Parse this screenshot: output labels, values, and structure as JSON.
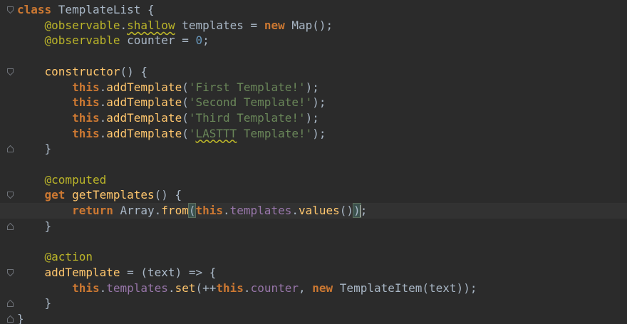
{
  "editor": {
    "lines": [
      [
        {
          "t": "class ",
          "c": "kw"
        },
        {
          "t": "TemplateList {",
          "c": ""
        }
      ],
      [
        {
          "t": "    ",
          "c": ""
        },
        {
          "t": "@observable",
          "c": "dec"
        },
        {
          "t": ".",
          "c": ""
        },
        {
          "t": "shallow",
          "c": "dec squiggle"
        },
        {
          "t": " templates = ",
          "c": ""
        },
        {
          "t": "new ",
          "c": "kw"
        },
        {
          "t": "Map();",
          "c": ""
        }
      ],
      [
        {
          "t": "    ",
          "c": ""
        },
        {
          "t": "@observable",
          "c": "dec"
        },
        {
          "t": " counter = ",
          "c": ""
        },
        {
          "t": "0",
          "c": "num"
        },
        {
          "t": ";",
          "c": ""
        }
      ],
      [],
      [
        {
          "t": "    ",
          "c": ""
        },
        {
          "t": "constructor",
          "c": "fn"
        },
        {
          "t": "() {",
          "c": ""
        }
      ],
      [
        {
          "t": "        ",
          "c": ""
        },
        {
          "t": "this",
          "c": "kw"
        },
        {
          "t": ".",
          "c": ""
        },
        {
          "t": "addTemplate",
          "c": "fn"
        },
        {
          "t": "(",
          "c": ""
        },
        {
          "t": "'First Template!'",
          "c": "str"
        },
        {
          "t": ");",
          "c": ""
        }
      ],
      [
        {
          "t": "        ",
          "c": ""
        },
        {
          "t": "this",
          "c": "kw"
        },
        {
          "t": ".",
          "c": ""
        },
        {
          "t": "addTemplate",
          "c": "fn"
        },
        {
          "t": "(",
          "c": ""
        },
        {
          "t": "'Second Template!'",
          "c": "str"
        },
        {
          "t": ");",
          "c": ""
        }
      ],
      [
        {
          "t": "        ",
          "c": ""
        },
        {
          "t": "this",
          "c": "kw"
        },
        {
          "t": ".",
          "c": ""
        },
        {
          "t": "addTemplate",
          "c": "fn"
        },
        {
          "t": "(",
          "c": ""
        },
        {
          "t": "'Third Template!'",
          "c": "str"
        },
        {
          "t": ");",
          "c": ""
        }
      ],
      [
        {
          "t": "        ",
          "c": ""
        },
        {
          "t": "this",
          "c": "kw"
        },
        {
          "t": ".",
          "c": ""
        },
        {
          "t": "addTemplate",
          "c": "fn"
        },
        {
          "t": "(",
          "c": ""
        },
        {
          "t": "'",
          "c": "str"
        },
        {
          "t": "LASTTT",
          "c": "str squiggle"
        },
        {
          "t": " Template!'",
          "c": "str"
        },
        {
          "t": ");",
          "c": ""
        }
      ],
      [
        {
          "t": "    }",
          "c": ""
        }
      ],
      [],
      [
        {
          "t": "    ",
          "c": ""
        },
        {
          "t": "@computed",
          "c": "dec"
        }
      ],
      [
        {
          "t": "    ",
          "c": ""
        },
        {
          "t": "get ",
          "c": "kw"
        },
        {
          "t": "getTemplates",
          "c": "fn"
        },
        {
          "t": "() {",
          "c": ""
        }
      ],
      [
        {
          "t": "        ",
          "c": ""
        },
        {
          "t": "return ",
          "c": "kw"
        },
        {
          "t": "Array.",
          "c": ""
        },
        {
          "t": "from",
          "c": "fn"
        },
        {
          "t": "(",
          "c": "bracket-match"
        },
        {
          "t": "this",
          "c": "kw"
        },
        {
          "t": ".",
          "c": ""
        },
        {
          "t": "templates",
          "c": "field"
        },
        {
          "t": ".",
          "c": ""
        },
        {
          "t": "values",
          "c": "fn"
        },
        {
          "t": "()",
          "c": ""
        },
        {
          "t": ")",
          "c": "bracket-match"
        },
        {
          "t": "",
          "c": "caret"
        },
        {
          "t": ";",
          "c": ""
        }
      ],
      [
        {
          "t": "    }",
          "c": ""
        }
      ],
      [],
      [
        {
          "t": "    ",
          "c": ""
        },
        {
          "t": "@action",
          "c": "dec"
        }
      ],
      [
        {
          "t": "    ",
          "c": ""
        },
        {
          "t": "addTemplate",
          "c": "fn"
        },
        {
          "t": " = (text) => {",
          "c": ""
        }
      ],
      [
        {
          "t": "        ",
          "c": ""
        },
        {
          "t": "this",
          "c": "kw"
        },
        {
          "t": ".",
          "c": ""
        },
        {
          "t": "templates",
          "c": "field"
        },
        {
          "t": ".",
          "c": ""
        },
        {
          "t": "set",
          "c": "fn"
        },
        {
          "t": "(++",
          "c": ""
        },
        {
          "t": "this",
          "c": "kw"
        },
        {
          "t": ".",
          "c": ""
        },
        {
          "t": "counter",
          "c": "field"
        },
        {
          "t": ", ",
          "c": ""
        },
        {
          "t": "new ",
          "c": "kw"
        },
        {
          "t": "TemplateItem(text));",
          "c": ""
        }
      ],
      [
        {
          "t": "    }",
          "c": ""
        }
      ],
      [
        {
          "t": "}",
          "c": ""
        }
      ]
    ],
    "current_line": 13,
    "fold_markers": [
      {
        "line": 0,
        "type": "open"
      },
      {
        "line": 4,
        "type": "open"
      },
      {
        "line": 9,
        "type": "close"
      },
      {
        "line": 12,
        "type": "open"
      },
      {
        "line": 14,
        "type": "close"
      },
      {
        "line": 17,
        "type": "open"
      },
      {
        "line": 19,
        "type": "close"
      },
      {
        "line": 20,
        "type": "close"
      }
    ],
    "colors": {
      "background": "#2b2b2b",
      "keyword": "#cc7832",
      "decorator": "#bbb529",
      "function": "#ffc66d",
      "string": "#6a8759",
      "number": "#6897bb",
      "field": "#9876aa",
      "text": "#a9b7c6"
    }
  }
}
